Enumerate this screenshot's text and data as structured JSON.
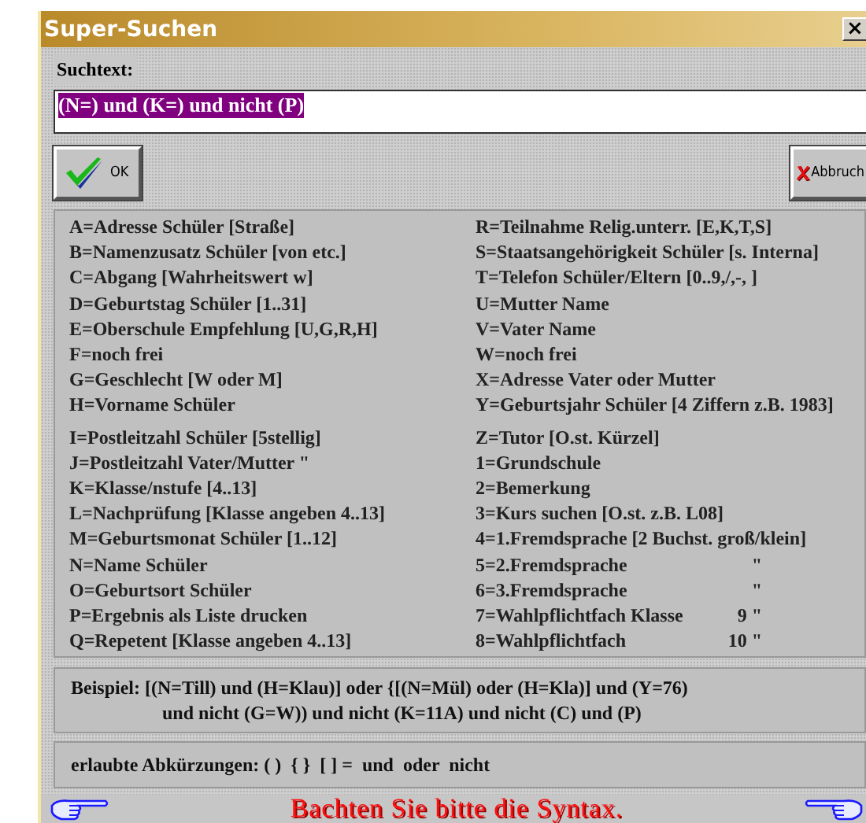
{
  "window": {
    "title": "Super-Suchen",
    "close": "×"
  },
  "search": {
    "label": "Suchtext:",
    "value": "(N=) und (K=) und nicht (P)",
    "selected": true
  },
  "buttons": [
    {
      "kind": "ok",
      "label": "OK"
    },
    {
      "kind": "cancel",
      "label": "Abbruch"
    }
  ],
  "legend": {
    "columns": [
      {
        "groups": [
          [
            {
              "text": "A=Adresse Schüler [Straße]"
            },
            {
              "text": "B=Namenzusatz Schüler [von etc.]"
            },
            {
              "text": "C=Abgang [Wahrheitswert w]"
            },
            {
              "text": "D=Geburtstag Schüler [1..31]"
            },
            {
              "text": "E=Oberschule Empfehlung [U,G,R,H]"
            },
            {
              "text": "F=noch frei"
            },
            {
              "text": "G=Geschlecht [W oder M]"
            },
            {
              "text": "H=Vorname Schüler"
            }
          ],
          [
            {
              "text": "I=Postleitzahl Schüler [5stellig]"
            },
            {
              "text": "J=Postleitzahl Vater/Mutter \""
            },
            {
              "text": "K=Klasse/nstufe [4..13]"
            },
            {
              "text": "L=Nachprüfung [Klasse angeben 4..13]"
            },
            {
              "text": "M=Geburtsmonat Schüler [1..12]"
            },
            {
              "text": "N=Name Schüler"
            },
            {
              "text": "O=Geburtsort Schüler"
            },
            {
              "text": "P=Ergebnis als Liste drucken"
            },
            {
              "text": "Q=Repetent [Klasse angeben 4..13]"
            }
          ]
        ]
      },
      {
        "groups": [
          [
            {
              "text": "R=Teilnahme Relig.unterr. [E,K,T,S]"
            },
            {
              "text": "S=Staatsangehörigkeit Schüler [s. Interna]"
            },
            {
              "text": "T=Telefon Schüler/Eltern [0..9,/,-, ]"
            },
            {
              "text": "U=Mutter Name"
            },
            {
              "text": "V=Vater Name"
            },
            {
              "text": "W=noch frei"
            },
            {
              "text": "X=Adresse Vater oder Mutter"
            },
            {
              "text": "Y=Geburtsjahr Schüler [4 Ziffern z.B. 1983]"
            }
          ],
          [
            {
              "text": "Z=Tutor [O.st. Kürzel]"
            },
            {
              "text": "1=Grundschule"
            },
            {
              "text": "2=Bemerkung"
            },
            {
              "text": "3=Kurs suchen [O.st. z.B. L08]"
            },
            {
              "text": "4=1.Fremdsprache [2 Buchst. groß/klein]"
            },
            {
              "text": "5=2.Fremdsprache",
              "suffix": "\""
            },
            {
              "text": "6=3.Fremdsprache",
              "suffix": "\""
            },
            {
              "text": "7=Wahlpflichtfach Klasse",
              "suffix": "9 \""
            },
            {
              "text": "8=Wahlpflichtfach",
              "suffix": "10 \""
            }
          ]
        ]
      }
    ]
  },
  "example": [
    "Beispiel: [(N=Till) und (H=Klau)] oder {[(N=Mül) oder (H=Kla)] und (Y=76)",
    "und nicht (G=W)) und nicht (K=11A) und nicht (C) und (P)"
  ],
  "abbreviations": "erlaubte Abkürzungen: ( )  { }  [ ] =  und  oder  nicht",
  "footer": "Bachten Sie bitte die Syntax."
}
